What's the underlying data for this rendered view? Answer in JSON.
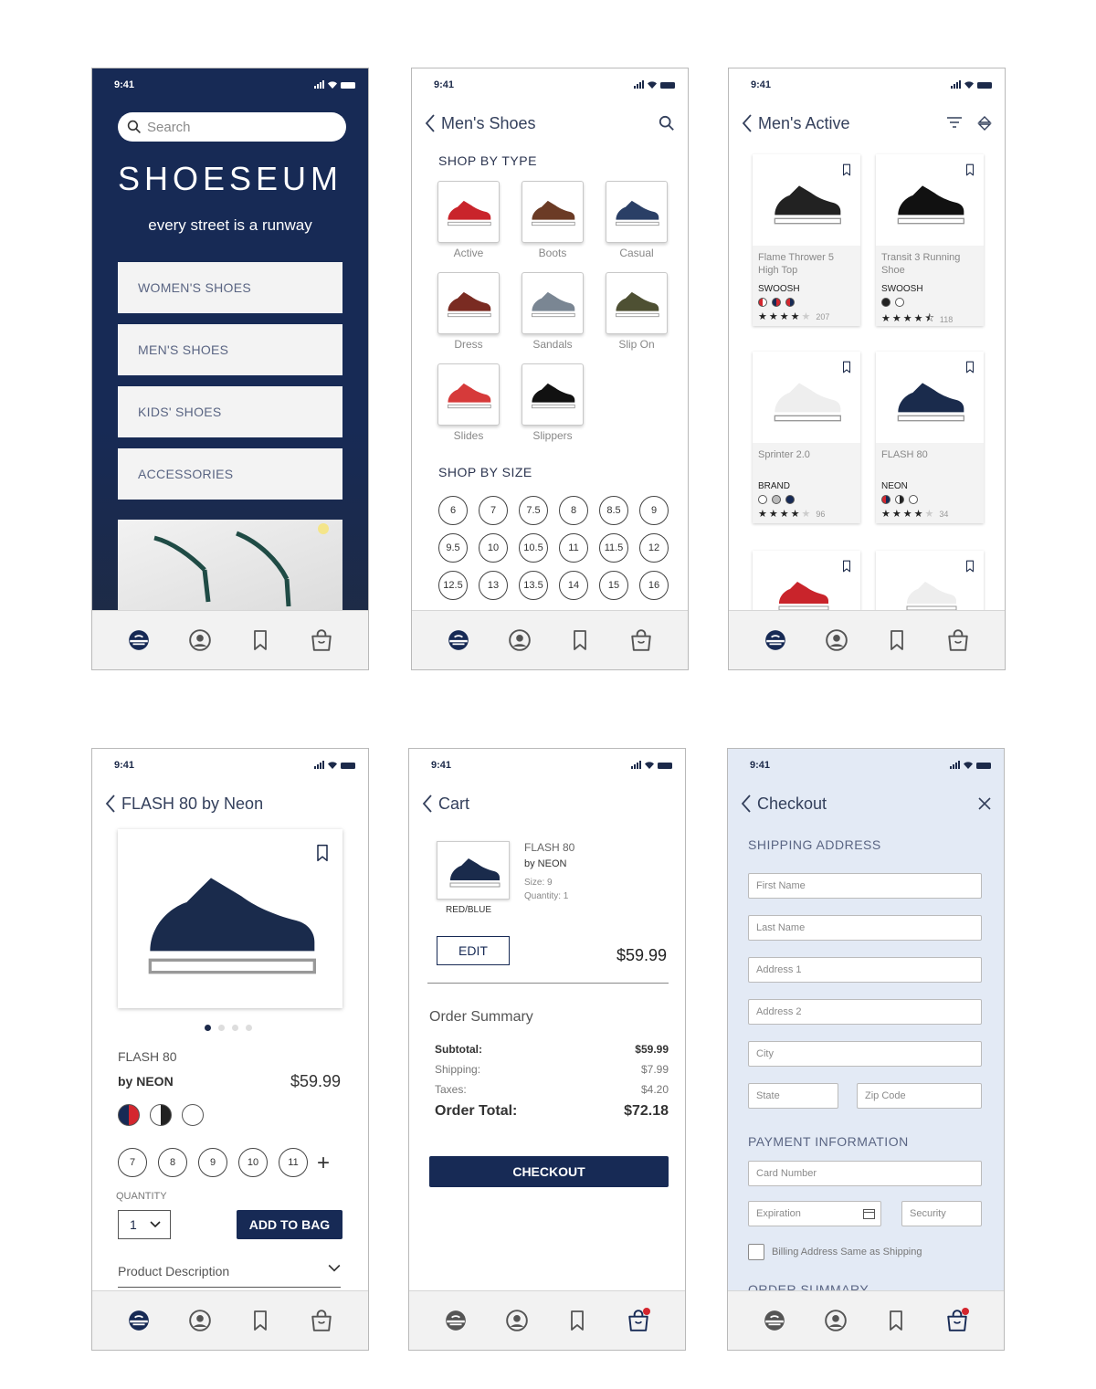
{
  "status_time": "9:41",
  "colors": {
    "navy": "#172a55",
    "red": "#d4262e"
  },
  "home": {
    "search_placeholder": "Search",
    "logo": "SHOESEUM",
    "tagline": "every street is a runway",
    "categories": [
      "WOMEN'S SHOES",
      "MEN'S SHOES",
      "KIDS' SHOES",
      "ACCESSORIES"
    ]
  },
  "mens": {
    "title": "Men's Shoes",
    "shop_by_type": "SHOP BY TYPE",
    "types": [
      "Active",
      "Boots",
      "Casual",
      "Dress",
      "Sandals",
      "Slip On",
      "Slides",
      "Slippers"
    ],
    "shop_by_size": "SHOP BY SIZE",
    "sizes": [
      "6",
      "7",
      "7.5",
      "8",
      "8.5",
      "9",
      "9.5",
      "10",
      "10.5",
      "11",
      "11.5",
      "12",
      "12.5",
      "13",
      "13.5",
      "14",
      "15",
      "16"
    ]
  },
  "active": {
    "title": "Men's Active",
    "products": [
      {
        "name": "Flame Thrower 5 High Top",
        "brand": "SWOOSH",
        "rating": 4,
        "count": "207"
      },
      {
        "name": "Transit 3 Running Shoe",
        "brand": "SWOOSH",
        "rating": 4.5,
        "count": "118"
      },
      {
        "name": "Sprinter 2.0",
        "brand": "BRAND",
        "rating": 4,
        "count": "96"
      },
      {
        "name": "FLASH 80",
        "brand": "NEON",
        "rating": 4,
        "count": "34"
      }
    ]
  },
  "detail": {
    "title": "FLASH 80 by Neon",
    "name": "FLASH 80",
    "brand": "by NEON",
    "price": "$59.99",
    "sizes": [
      "7",
      "8",
      "9",
      "10",
      "11"
    ],
    "quantity_label": "QUANTITY",
    "quantity": "1",
    "add_to_bag": "ADD TO BAG",
    "description": "Product Description"
  },
  "cart": {
    "title": "Cart",
    "item_name": "FLASH 80",
    "item_brand": "by NEON",
    "size": "Size: 9",
    "quantity": "Quantity: 1",
    "color": "RED/BLUE",
    "edit": "EDIT",
    "price": "$59.99",
    "summary": "Order Summary",
    "subtotal_label": "Subtotal:",
    "subtotal": "$59.99",
    "shipping_label": "Shipping:",
    "shipping": "$7.99",
    "taxes_label": "Taxes:",
    "taxes": "$4.20",
    "total_label": "Order Total:",
    "total": "$72.18",
    "checkout": "CHECKOUT"
  },
  "checkout": {
    "title": "Checkout",
    "shipping_header": "SHIPPING ADDRESS",
    "first_name": "First Name",
    "last_name": "Last Name",
    "address1": "Address 1",
    "address2": "Address 2",
    "city": "City",
    "state": "State",
    "zip": "Zip Code",
    "payment_header": "PAYMENT INFORMATION",
    "card": "Card Number",
    "expiration": "Expiration",
    "security": "Security",
    "billing_same": "Billing Address Same as Shipping",
    "order_summary": "ORDER SUMMARY"
  }
}
